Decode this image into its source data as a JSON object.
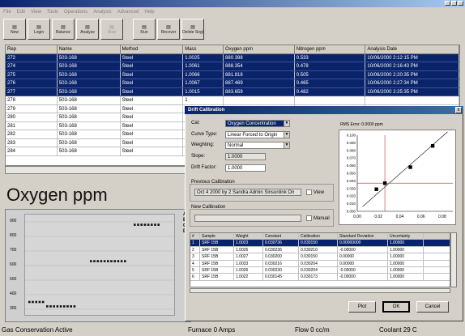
{
  "window": {
    "title": ""
  },
  "menu": [
    "File",
    "Edit",
    "View",
    "Tools",
    "Operations",
    "Analysis",
    "Advanced",
    "Help"
  ],
  "toolbar": [
    {
      "label": "New",
      "icon": "new-icon",
      "enabled": true
    },
    {
      "label": "Login",
      "icon": "login-icon",
      "enabled": true
    },
    {
      "label": "Balance",
      "icon": "balance-icon",
      "enabled": true
    },
    {
      "label": "Analyze",
      "icon": "analyze-icon",
      "enabled": true
    },
    {
      "label": "Stop",
      "icon": "stop-icon",
      "enabled": false
    },
    {
      "label": "Run",
      "icon": "run-icon",
      "enabled": true
    },
    {
      "label": "Recover",
      "icon": "recover-icon",
      "enabled": true
    },
    {
      "label": "Delete Sngl",
      "icon": "delete-icon",
      "enabled": true
    }
  ],
  "grid": {
    "columns": [
      "Rep",
      "Name",
      "Method",
      "Mass",
      "Oxygen ppm",
      "Nitrogen ppm",
      "Analysis Date"
    ],
    "rows": [
      {
        "cells": [
          "272",
          "503-168",
          "Steel",
          "1.0025",
          "880.398",
          "0.533",
          "10/06/2000 2:12:15 PM"
        ],
        "selected": true
      },
      {
        "cells": [
          "274",
          "503-168",
          "Steel",
          "1.0061",
          "888.354",
          "0.478",
          "10/06/2000 2:16:43 PM"
        ],
        "selected": true
      },
      {
        "cells": [
          "275",
          "503-168",
          "Steel",
          "1.0066",
          "881.818",
          "0.505",
          "10/06/2000 2:20:35 PM"
        ],
        "selected": true
      },
      {
        "cells": [
          "276",
          "503-168",
          "Steel",
          "1.0067",
          "887.469",
          "0.465",
          "10/06/2000 2:27:34 PM"
        ],
        "selected": true
      },
      {
        "cells": [
          "277",
          "503-168",
          "Steel",
          "1.0015",
          "883.659",
          "0.482",
          "10/06/2000 2:25:35 PM"
        ],
        "selected": true
      },
      {
        "cells": [
          "278",
          "503-168",
          "Steel",
          "1",
          "",
          "",
          ""
        ],
        "selected": false
      },
      {
        "cells": [
          "279",
          "503-168",
          "Steel",
          "1",
          "",
          "",
          ""
        ],
        "selected": false
      },
      {
        "cells": [
          "280",
          "503-168",
          "Steel",
          "1",
          "",
          "",
          ""
        ],
        "selected": false
      },
      {
        "cells": [
          "281",
          "503-168",
          "Steel",
          "1",
          "",
          "",
          ""
        ],
        "selected": false
      },
      {
        "cells": [
          "282",
          "503-168",
          "Steel",
          "1",
          "",
          "",
          ""
        ],
        "selected": false
      },
      {
        "cells": [
          "283",
          "503-168",
          "Steel",
          "1",
          "",
          "",
          ""
        ],
        "selected": false
      },
      {
        "cells": [
          "284",
          "503-168",
          "Steel",
          "1",
          "",
          "",
          ""
        ],
        "selected": false
      }
    ]
  },
  "oxygen_chart": {
    "title": "Oxygen ppm",
    "y_ticks": [
      "900",
      "800",
      "700",
      "600",
      "500",
      "400",
      "300"
    ],
    "side_letters": [
      "A",
      "B",
      "C",
      "D"
    ],
    "groups": [
      {
        "y": 350,
        "count": 5
      },
      {
        "y": 320,
        "count": 9
      },
      {
        "y": 630,
        "count": 11
      },
      {
        "y": 880,
        "count": 8
      }
    ]
  },
  "dialog": {
    "title": "Drift Calibration",
    "close_label": "x",
    "fields": {
      "cal_label": "Cal:",
      "cal_value": "Oxygen Concentration",
      "curve_label": "Curve Type:",
      "curve_value": "Linear Forced to Origin",
      "weighting_label": "Weighting:",
      "weighting_value": "Normal",
      "slope_label": "Slope:",
      "slope_value": "1.0000",
      "drift_label": "Drift Factor:",
      "drift_value": "1.0000"
    },
    "previous_group_label": "Previous Calibration",
    "previous_value": "Oct 4 2000 by 2 Sandra Admin Sinsonlink On",
    "view_label": "View",
    "new_group_label": "New Calibration",
    "new_value": "",
    "manual_label": "Manual",
    "plot_header": "RMS Error: 0.0000 ppm",
    "plot": {
      "x_ticks": [
        "0.00",
        "0.02",
        "0.04",
        "0.06",
        "0.08"
      ],
      "y_ticks": [
        "0.100",
        "0.090",
        "0.080",
        "0.070",
        "0.060",
        "0.050",
        "0.040",
        "0.030",
        "0.020",
        "0.010",
        "0.000"
      ],
      "points": [
        {
          "x": 0.018,
          "y": 0.029
        },
        {
          "x": 0.026,
          "y": 0.037
        },
        {
          "x": 0.05,
          "y": 0.058
        },
        {
          "x": 0.071,
          "y": 0.086
        }
      ],
      "marker": {
        "x": 0.026,
        "y": 0.037
      }
    },
    "table": {
      "columns": [
        "#",
        "Sample",
        "Weight",
        "Constant",
        "Calibration",
        "Standard Deviation",
        "Uncertainty"
      ],
      "rows": [
        {
          "cells": [
            "1",
            "SRF 15B",
            "1.0023",
            "0.030736",
            "0.030150",
            "0.00000000",
            "1.00000"
          ],
          "selected": true
        },
        {
          "cells": [
            "2",
            "SRF 15B",
            "1.0026",
            "0.030236",
            "0.030210",
            "-0.00000",
            "1.00000"
          ],
          "selected": false
        },
        {
          "cells": [
            "3",
            "SRF 15B",
            "1.0027",
            "0.030200",
            "0.030150",
            "0.00000",
            "1.00000"
          ],
          "selected": false
        },
        {
          "cells": [
            "4",
            "SRF 15B",
            "1.0033",
            "0.030216",
            "0.030204",
            "0.00000",
            "1.00000"
          ],
          "selected": false
        },
        {
          "cells": [
            "5",
            "SRF 15B",
            "1.0026",
            "0.030230",
            "0.030204",
            "-0.00000",
            "1.00000"
          ],
          "selected": false
        },
        {
          "cells": [
            "6",
            "SRF 15B",
            "1.0022",
            "0.030145",
            "0.030173",
            "-0.00000",
            "1.00000"
          ],
          "selected": false
        }
      ]
    },
    "buttons": {
      "plot": "Plot",
      "ok": "OK",
      "cancel": "Cancel"
    }
  },
  "status": {
    "gas": "Gas Conservation Active",
    "furnace": "Furnace 0 Amps",
    "flow": "Flow 0 cc/m",
    "coolant": "Coolant 29 C"
  },
  "colors": {
    "selection": "#0a246a",
    "face": "#d4d0c8",
    "red_line": "#d04848"
  }
}
